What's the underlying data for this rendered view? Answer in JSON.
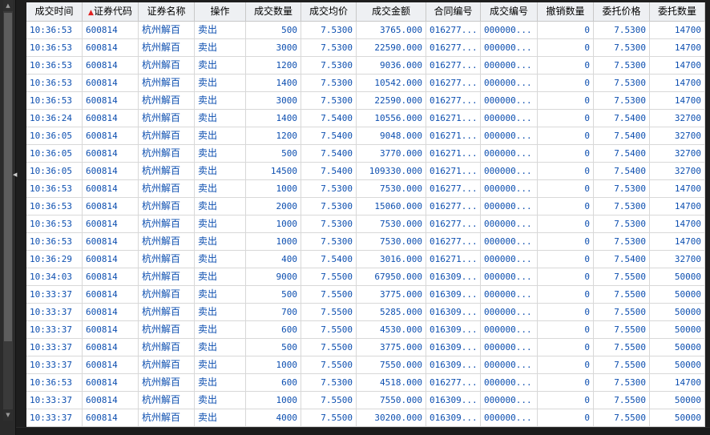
{
  "columns": [
    "成交时间",
    "证券代码",
    "证券名称",
    "操作",
    "成交数量",
    "成交均价",
    "成交金额",
    "合同编号",
    "成交编号",
    "撤销数量",
    "委托价格",
    "委托数量"
  ],
  "sort_indicator": "▲",
  "rows": [
    [
      "10:36:53",
      "600814",
      "杭州解百",
      "卖出",
      "500",
      "7.5300",
      "3765.000",
      "016277...",
      "000000...",
      "0",
      "7.5300",
      "14700"
    ],
    [
      "10:36:53",
      "600814",
      "杭州解百",
      "卖出",
      "3000",
      "7.5300",
      "22590.000",
      "016277...",
      "000000...",
      "0",
      "7.5300",
      "14700"
    ],
    [
      "10:36:53",
      "600814",
      "杭州解百",
      "卖出",
      "1200",
      "7.5300",
      "9036.000",
      "016277...",
      "000000...",
      "0",
      "7.5300",
      "14700"
    ],
    [
      "10:36:53",
      "600814",
      "杭州解百",
      "卖出",
      "1400",
      "7.5300",
      "10542.000",
      "016277...",
      "000000...",
      "0",
      "7.5300",
      "14700"
    ],
    [
      "10:36:53",
      "600814",
      "杭州解百",
      "卖出",
      "3000",
      "7.5300",
      "22590.000",
      "016277...",
      "000000...",
      "0",
      "7.5300",
      "14700"
    ],
    [
      "10:36:24",
      "600814",
      "杭州解百",
      "卖出",
      "1400",
      "7.5400",
      "10556.000",
      "016271...",
      "000000...",
      "0",
      "7.5400",
      "32700"
    ],
    [
      "10:36:05",
      "600814",
      "杭州解百",
      "卖出",
      "1200",
      "7.5400",
      "9048.000",
      "016271...",
      "000000...",
      "0",
      "7.5400",
      "32700"
    ],
    [
      "10:36:05",
      "600814",
      "杭州解百",
      "卖出",
      "500",
      "7.5400",
      "3770.000",
      "016271...",
      "000000...",
      "0",
      "7.5400",
      "32700"
    ],
    [
      "10:36:05",
      "600814",
      "杭州解百",
      "卖出",
      "14500",
      "7.5400",
      "109330.000",
      "016271...",
      "000000...",
      "0",
      "7.5400",
      "32700"
    ],
    [
      "10:36:53",
      "600814",
      "杭州解百",
      "卖出",
      "1000",
      "7.5300",
      "7530.000",
      "016277...",
      "000000...",
      "0",
      "7.5300",
      "14700"
    ],
    [
      "10:36:53",
      "600814",
      "杭州解百",
      "卖出",
      "2000",
      "7.5300",
      "15060.000",
      "016277...",
      "000000...",
      "0",
      "7.5300",
      "14700"
    ],
    [
      "10:36:53",
      "600814",
      "杭州解百",
      "卖出",
      "1000",
      "7.5300",
      "7530.000",
      "016277...",
      "000000...",
      "0",
      "7.5300",
      "14700"
    ],
    [
      "10:36:53",
      "600814",
      "杭州解百",
      "卖出",
      "1000",
      "7.5300",
      "7530.000",
      "016277...",
      "000000...",
      "0",
      "7.5300",
      "14700"
    ],
    [
      "10:36:29",
      "600814",
      "杭州解百",
      "卖出",
      "400",
      "7.5400",
      "3016.000",
      "016271...",
      "000000...",
      "0",
      "7.5400",
      "32700"
    ],
    [
      "10:34:03",
      "600814",
      "杭州解百",
      "卖出",
      "9000",
      "7.5500",
      "67950.000",
      "016309...",
      "000000...",
      "0",
      "7.5500",
      "50000"
    ],
    [
      "10:33:37",
      "600814",
      "杭州解百",
      "卖出",
      "500",
      "7.5500",
      "3775.000",
      "016309...",
      "000000...",
      "0",
      "7.5500",
      "50000"
    ],
    [
      "10:33:37",
      "600814",
      "杭州解百",
      "卖出",
      "700",
      "7.5500",
      "5285.000",
      "016309...",
      "000000...",
      "0",
      "7.5500",
      "50000"
    ],
    [
      "10:33:37",
      "600814",
      "杭州解百",
      "卖出",
      "600",
      "7.5500",
      "4530.000",
      "016309...",
      "000000...",
      "0",
      "7.5500",
      "50000"
    ],
    [
      "10:33:37",
      "600814",
      "杭州解百",
      "卖出",
      "500",
      "7.5500",
      "3775.000",
      "016309...",
      "000000...",
      "0",
      "7.5500",
      "50000"
    ],
    [
      "10:33:37",
      "600814",
      "杭州解百",
      "卖出",
      "1000",
      "7.5500",
      "7550.000",
      "016309...",
      "000000...",
      "0",
      "7.5500",
      "50000"
    ],
    [
      "10:36:53",
      "600814",
      "杭州解百",
      "卖出",
      "600",
      "7.5300",
      "4518.000",
      "016277...",
      "000000...",
      "0",
      "7.5300",
      "14700"
    ],
    [
      "10:33:37",
      "600814",
      "杭州解百",
      "卖出",
      "1000",
      "7.5500",
      "7550.000",
      "016309...",
      "000000...",
      "0",
      "7.5500",
      "50000"
    ],
    [
      "10:33:37",
      "600814",
      "杭州解百",
      "卖出",
      "4000",
      "7.5500",
      "30200.000",
      "016309...",
      "000000...",
      "0",
      "7.5500",
      "50000"
    ]
  ],
  "colors": {
    "header_bg": "#eef0f3",
    "cell_text": "#0d4fb0",
    "sort_arrow": "#e02020"
  }
}
